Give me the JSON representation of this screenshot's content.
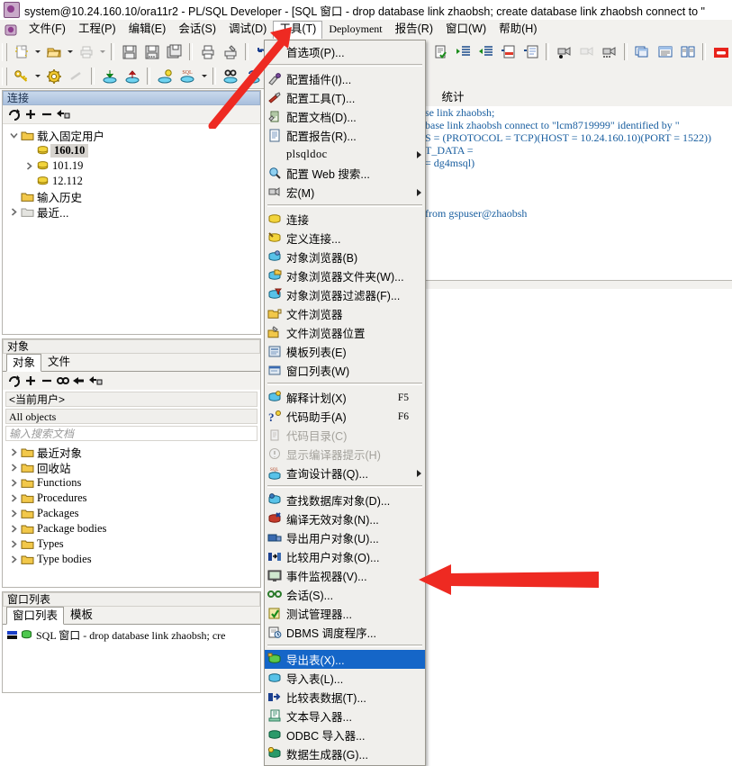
{
  "window": {
    "title": "system@10.24.160.10/ora11r2 - PL/SQL Developer - [SQL 窗口 - drop database link zhaobsh; create database link zhaobsh connect to \"",
    "app_icon": "plsql-developer-icon"
  },
  "menubar": {
    "items": [
      {
        "label": "文件(F)",
        "name": "menu-file",
        "active": false,
        "latin": false
      },
      {
        "label": "工程(P)",
        "name": "menu-project",
        "active": false,
        "latin": false
      },
      {
        "label": "编辑(E)",
        "name": "menu-edit",
        "active": false,
        "latin": false
      },
      {
        "label": "会话(S)",
        "name": "menu-session",
        "active": false,
        "latin": false
      },
      {
        "label": "调试(D)",
        "name": "menu-debug",
        "active": false,
        "latin": false
      },
      {
        "label": "工具(T)",
        "name": "menu-tools",
        "active": true,
        "latin": false
      },
      {
        "label": "Deployment",
        "name": "menu-deployment",
        "active": false,
        "latin": true
      },
      {
        "label": "报告(R)",
        "name": "menu-report",
        "active": false,
        "latin": false
      },
      {
        "label": "窗口(W)",
        "name": "menu-window",
        "active": false,
        "latin": false
      },
      {
        "label": "帮助(H)",
        "name": "menu-help",
        "active": false,
        "latin": false
      }
    ]
  },
  "tools_menu": {
    "items": [
      {
        "type": "item",
        "label": "首选项(P)...",
        "icon": "preferences-icon",
        "name": "tools-preferences"
      },
      {
        "type": "separator"
      },
      {
        "type": "item",
        "label": "配置插件(I)...",
        "icon": "plugin-icon",
        "name": "tools-configure-plugins"
      },
      {
        "type": "item",
        "label": "配置工具(T)...",
        "icon": "tools-icon",
        "name": "tools-configure-tools"
      },
      {
        "type": "item",
        "label": "配置文档(D)...",
        "icon": "document-icon",
        "name": "tools-configure-docs"
      },
      {
        "type": "item",
        "label": "配置报告(R)...",
        "icon": "report-icon",
        "name": "tools-configure-reports"
      },
      {
        "type": "submenu",
        "label": "plsqldoc",
        "icon": "none",
        "name": "tools-plsqldoc",
        "mono": true
      },
      {
        "type": "item",
        "label": "配置 Web 搜索...",
        "icon": "web-search-icon",
        "name": "tools-configure-web-search"
      },
      {
        "type": "submenu",
        "label": "宏(M)",
        "icon": "macro-icon",
        "name": "tools-macro"
      },
      {
        "type": "separator"
      },
      {
        "type": "item",
        "label": "连接",
        "icon": "connect-icon",
        "name": "tools-connect"
      },
      {
        "type": "item",
        "label": "定义连接...",
        "icon": "define-connection-icon",
        "name": "tools-define-connection"
      },
      {
        "type": "item",
        "label": "对象浏览器(B)",
        "icon": "object-browser-icon",
        "name": "tools-object-browser"
      },
      {
        "type": "item",
        "label": "对象浏览器文件夹(W)...",
        "icon": "object-browser-folder-icon",
        "name": "tools-object-browser-folders"
      },
      {
        "type": "item",
        "label": "对象浏览器过滤器(F)...",
        "icon": "object-browser-filter-icon",
        "name": "tools-object-browser-filters"
      },
      {
        "type": "item",
        "label": "文件浏览器",
        "icon": "file-browser-icon",
        "name": "tools-file-browser"
      },
      {
        "type": "item",
        "label": "文件浏览器位置",
        "icon": "file-browser-location-icon",
        "name": "tools-file-browser-location"
      },
      {
        "type": "item",
        "label": "模板列表(E)",
        "icon": "template-list-icon",
        "name": "tools-template-list"
      },
      {
        "type": "item",
        "label": "窗口列表(W)",
        "icon": "window-list-icon",
        "name": "tools-window-list"
      },
      {
        "type": "separator"
      },
      {
        "type": "item",
        "label": "解释计划(X)",
        "icon": "explain-plan-icon",
        "name": "tools-explain-plan",
        "shortcut": "F5"
      },
      {
        "type": "item",
        "label": "代码助手(A)",
        "icon": "code-assistant-icon",
        "name": "tools-code-assistant",
        "shortcut": "F6"
      },
      {
        "type": "item",
        "label": "代码目录(C)",
        "icon": "code-contents-icon",
        "name": "tools-code-contents",
        "disabled": true
      },
      {
        "type": "item",
        "label": "显示编译器提示(H)",
        "icon": "compiler-hints-icon",
        "name": "tools-compiler-hints",
        "disabled": true
      },
      {
        "type": "submenu",
        "label": "查询设计器(Q)...",
        "icon": "query-builder-icon",
        "name": "tools-query-builder"
      },
      {
        "type": "separator"
      },
      {
        "type": "item",
        "label": "查找数据库对象(D)...",
        "icon": "find-db-object-icon",
        "name": "tools-find-database-objects"
      },
      {
        "type": "item",
        "label": "编译无效对象(N)...",
        "icon": "compile-invalid-icon",
        "name": "tools-compile-invalid-objects"
      },
      {
        "type": "item",
        "label": "导出用户对象(U)...",
        "icon": "export-user-objects-icon",
        "name": "tools-export-user-objects"
      },
      {
        "type": "item",
        "label": "比较用户对象(O)...",
        "icon": "compare-user-objects-icon",
        "name": "tools-compare-user-objects"
      },
      {
        "type": "item",
        "label": "事件监视器(V)...",
        "icon": "event-monitor-icon",
        "name": "tools-event-monitor"
      },
      {
        "type": "item",
        "label": "会话(S)...",
        "icon": "sessions-icon",
        "name": "tools-sessions"
      },
      {
        "type": "item",
        "label": "测试管理器...",
        "icon": "test-manager-icon",
        "name": "tools-test-manager"
      },
      {
        "type": "item",
        "label": "DBMS 调度程序...",
        "icon": "dbms-scheduler-icon",
        "name": "tools-dbms-scheduler",
        "mono_prefix": true
      },
      {
        "type": "separator"
      },
      {
        "type": "item",
        "label": "导出表(X)...",
        "icon": "export-tables-icon",
        "name": "tools-export-tables",
        "selected": true
      },
      {
        "type": "item",
        "label": "导入表(L)...",
        "icon": "import-tables-icon",
        "name": "tools-import-tables"
      },
      {
        "type": "item",
        "label": "比较表数据(T)...",
        "icon": "compare-table-data-icon",
        "name": "tools-compare-table-data"
      },
      {
        "type": "item",
        "label": "文本导入器...",
        "icon": "text-importer-icon",
        "name": "tools-text-importer"
      },
      {
        "type": "item",
        "label": "ODBC 导入器...",
        "icon": "odbc-importer-icon",
        "name": "tools-odbc-importer",
        "mono_prefix": true
      },
      {
        "type": "item",
        "label": "数据生成器(G)...",
        "icon": "data-generator-icon",
        "name": "tools-data-generator"
      }
    ]
  },
  "connections_panel": {
    "title": "连接",
    "toolbar": [
      "refresh-icon",
      "plus-icon",
      "minus-icon",
      "connect-user-icon"
    ],
    "tree": [
      {
        "label": "载入固定用户",
        "icon": "folder-icon",
        "expander": "expanded",
        "indent": 0,
        "selected": false,
        "mono": false
      },
      {
        "label": "160.10",
        "icon": "database-icon",
        "expander": "none",
        "indent": 1,
        "selected": true,
        "mono": true
      },
      {
        "label": "101.19",
        "icon": "database-icon",
        "expander": "collapsed",
        "indent": 1,
        "selected": false,
        "mono": true
      },
      {
        "label": "12.112",
        "icon": "database-icon",
        "expander": "none",
        "indent": 1,
        "selected": false,
        "mono": true
      },
      {
        "label": "输入历史",
        "icon": "folder-icon",
        "expander": "none",
        "indent": 0,
        "selected": false,
        "mono": false
      },
      {
        "label": "最近...",
        "icon": "folder-gray-icon",
        "expander": "collapsed",
        "indent": 0,
        "selected": false,
        "mono": false
      }
    ]
  },
  "objects_panel": {
    "title": "对象",
    "tabs": [
      {
        "label": "对象",
        "selected": true,
        "name": "tab-objects"
      },
      {
        "label": "文件",
        "selected": false,
        "name": "tab-files"
      }
    ],
    "toolbar": [
      "refresh-icon",
      "plus-icon",
      "minus-icon",
      "find-icon",
      "filter-icon",
      "connect-user-icon"
    ],
    "user_selector": "<当前用户>",
    "filter_selector": "All objects",
    "search_placeholder": "输入搜索文档",
    "tree": [
      {
        "label": "最近对象",
        "mono": false
      },
      {
        "label": "回收站",
        "mono": false
      },
      {
        "label": "Functions",
        "mono": true
      },
      {
        "label": "Procedures",
        "mono": true
      },
      {
        "label": "Packages",
        "mono": true
      },
      {
        "label": "Package bodies",
        "mono": true
      },
      {
        "label": "Types",
        "mono": true
      },
      {
        "label": "Type bodies",
        "mono": true
      }
    ]
  },
  "windows_panel": {
    "title": "窗口列表",
    "tabs": [
      {
        "label": "窗口列表",
        "selected": true,
        "name": "tab-window-list"
      },
      {
        "label": "模板",
        "selected": false,
        "name": "tab-templates"
      }
    ],
    "items": [
      {
        "label": "SQL 窗口 - drop database link zhaobsh; cre",
        "icon": "sql-window-icon"
      }
    ]
  },
  "editor": {
    "tabs": [
      {
        "label": "统计",
        "selected": false,
        "name": "tab-statistics"
      }
    ],
    "lines": [
      "se link zhaobsh;",
      "base link zhaobsh connect to \"lcm8719999\" identified by \"",
      "S = (PROTOCOL = TCP)(HOST = 10.24.160.10)(PORT = 1522))",
      "T_DATA =",
      "= dg4msql)",
      "",
      "",
      "",
      "from gspuser@zhaobsh"
    ]
  },
  "annotations": {
    "arrows": [
      {
        "name": "arrow-pointing-tools-menu",
        "color": "#ee2a22"
      },
      {
        "name": "arrow-pointing-export-tables",
        "color": "#ee2a22"
      }
    ]
  },
  "colors": {
    "menu_highlight": "#1566c8",
    "panel_title_gradient_start": "#c8d8ec",
    "panel_title_gradient_end": "#a9c0dd",
    "annotation_red": "#ee2a22",
    "sql_text": "#1a5fa0"
  }
}
